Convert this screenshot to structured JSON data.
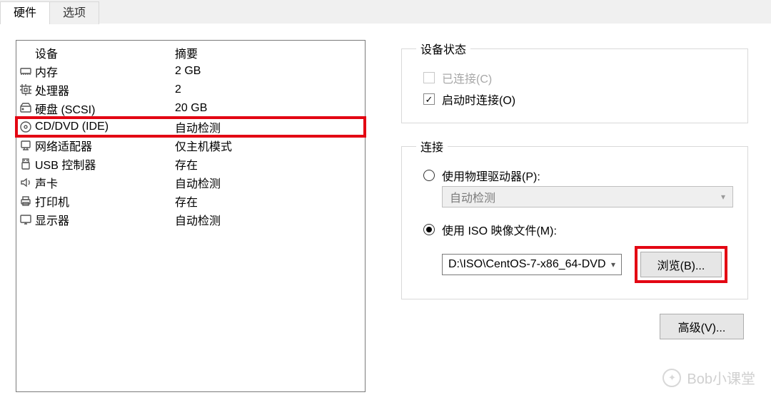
{
  "tabs": {
    "hardware": "硬件",
    "options": "选项"
  },
  "headers": {
    "device": "设备",
    "summary": "摘要"
  },
  "devices": [
    {
      "icon": "memory",
      "name": "内存",
      "summary": "2 GB"
    },
    {
      "icon": "cpu",
      "name": "处理器",
      "summary": "2"
    },
    {
      "icon": "hdd",
      "name": "硬盘 (SCSI)",
      "summary": "20 GB"
    },
    {
      "icon": "cd",
      "name": "CD/DVD (IDE)",
      "summary": "自动检测",
      "highlight": true
    },
    {
      "icon": "net",
      "name": "网络适配器",
      "summary": "仅主机模式"
    },
    {
      "icon": "usb",
      "name": "USB 控制器",
      "summary": "存在"
    },
    {
      "icon": "sound",
      "name": "声卡",
      "summary": "自动检测"
    },
    {
      "icon": "printer",
      "name": "打印机",
      "summary": "存在"
    },
    {
      "icon": "display",
      "name": "显示器",
      "summary": "自动检测"
    }
  ],
  "status": {
    "legend": "设备状态",
    "connected": "已连接(C)",
    "connect_at_power_on": "启动时连接(O)"
  },
  "connection": {
    "legend": "连接",
    "use_physical": "使用物理驱动器(P):",
    "physical_value": "自动检测",
    "use_iso": "使用 ISO 映像文件(M):",
    "iso_value": "D:\\ISO\\CentOS-7-x86_64-DVD",
    "browse": "浏览(B)..."
  },
  "advanced": "高级(V)...",
  "watermark": "Bob小课堂"
}
